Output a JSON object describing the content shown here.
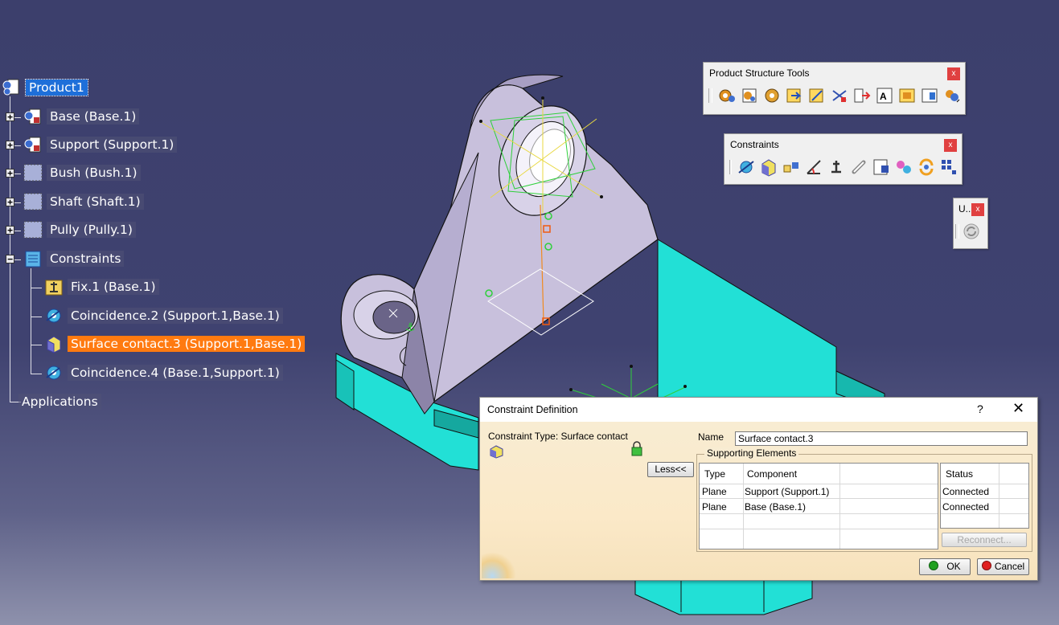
{
  "tree": {
    "root": "Product1",
    "items": [
      {
        "label": "Base (Base.1)"
      },
      {
        "label": "Support (Support.1)"
      },
      {
        "label": "Bush (Bush.1)"
      },
      {
        "label": "Shaft (Shaft.1)"
      },
      {
        "label": "Pully (Pully.1)"
      },
      {
        "label": "Constraints"
      }
    ],
    "constraints": [
      {
        "label": "Fix.1 (Base.1)"
      },
      {
        "label": "Coincidence.2 (Support.1,Base.1)"
      },
      {
        "label": "Surface contact.3 (Support.1,Base.1)"
      },
      {
        "label": "Coincidence.4 (Base.1,Support.1)"
      }
    ],
    "applications": "Applications"
  },
  "toolbars": {
    "product_structure": {
      "title": "Product Structure Tools",
      "close": "x",
      "icons": [
        "component-icon",
        "product-icon",
        "part-icon",
        "existing-component-icon",
        "existing-component-positioning-icon",
        "replace-component-icon",
        "graph-tree-reordering-icon",
        "generate-numbering-icon",
        "selective-load-icon",
        "manage-representations-icon",
        "multi-instantiation-icon"
      ]
    },
    "constraints": {
      "title": "Constraints",
      "close": "x",
      "icons": [
        "coincidence-constraint-icon",
        "contact-constraint-icon",
        "offset-constraint-icon",
        "angle-constraint-icon",
        "fix-component-icon",
        "fix-together-icon",
        "quick-constraint-icon",
        "flexible-rigid-icon",
        "change-constraint-icon",
        "reuse-pattern-icon"
      ]
    },
    "update": {
      "title": "U..",
      "close": "x",
      "icons": [
        "update-icon"
      ]
    }
  },
  "dialog": {
    "title": "Constraint Definition",
    "help": "?",
    "close": "✕",
    "constraint_type": "Constraint Type: Surface contact",
    "name_label": "Name",
    "name_value": "Surface contact.3",
    "supporting_elements": "Supporting Elements",
    "less_button": "Less<<",
    "columns": {
      "type": "Type",
      "component": "Component",
      "status": "Status"
    },
    "rows": [
      {
        "type": "Plane",
        "component": "Support (Support.1)",
        "status": "Connected"
      },
      {
        "type": "Plane",
        "component": "Base (Base.1)",
        "status": "Connected"
      }
    ],
    "reconnect_button": "Reconnect...",
    "ok_button": "OK",
    "cancel_button": "Cancel"
  },
  "colors": {
    "background": "#3f4270",
    "selection": "#ff7a10",
    "root_highlight": "#1e6fd9",
    "base_part": "#22e0d6",
    "support_part": "#c8c0dc",
    "dialog_bg": "#f7e8c8"
  }
}
